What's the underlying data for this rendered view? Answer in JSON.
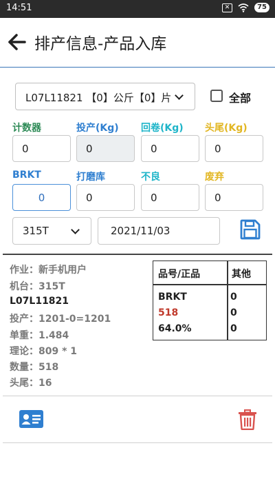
{
  "status": {
    "time": "14:51",
    "battery": "75",
    "x_icon": "close-box-icon",
    "wifi_icon": "wifi-icon"
  },
  "header": {
    "title": "排产信息-产品入库",
    "back_icon": "arrow-left-icon"
  },
  "filter": {
    "selected": "L07L11821 【0】公斤【0】片",
    "all_label": "全部",
    "all_checked": false
  },
  "fields_row1": [
    {
      "label": "计数器",
      "value": "0",
      "color": "#2e8b57"
    },
    {
      "label": "投产(Kg)",
      "value": "0",
      "color": "#2f7fd0"
    },
    {
      "label": "回卷(Kg)",
      "value": "0",
      "color": "#1fb5c9"
    },
    {
      "label": "头尾(Kg)",
      "value": "0",
      "color": "#e2b622"
    }
  ],
  "fields_row2": [
    {
      "label": "BRKT",
      "value": "0",
      "color": "#2f7fd0"
    },
    {
      "label": "打磨库",
      "value": "0",
      "color": "#2f7fd0"
    },
    {
      "label": "不良",
      "value": "0",
      "color": "#1fb5c9"
    },
    {
      "label": "废弃",
      "value": "0",
      "color": "#e2b622"
    }
  ],
  "model_select": {
    "value": "315T"
  },
  "date_field": {
    "value": "2021/11/03"
  },
  "save_icon": "save-icon",
  "info": {
    "operator": "作业：新手机用户",
    "machine": "机台：315T",
    "part_no": "L07L11821",
    "production": "投产：1201-0=1201",
    "unit_weight": "单重：1.484",
    "theory": "理论：809 * 1",
    "quantity": "数量：518",
    "head_tail": "头尾：16"
  },
  "table": {
    "headers": [
      "品号/正品",
      "其他"
    ],
    "rows": [
      {
        "a": "BRKT",
        "b": "0"
      },
      {
        "a": "518",
        "b": "0"
      },
      {
        "a": "64.0%",
        "b": "0"
      }
    ]
  },
  "footer": {
    "card_icon": "id-card-icon",
    "trash_icon": "trash-icon"
  },
  "colors": {
    "accent": "#2f7fd0",
    "danger": "#d9534f",
    "header_line": "#3a76b8"
  }
}
